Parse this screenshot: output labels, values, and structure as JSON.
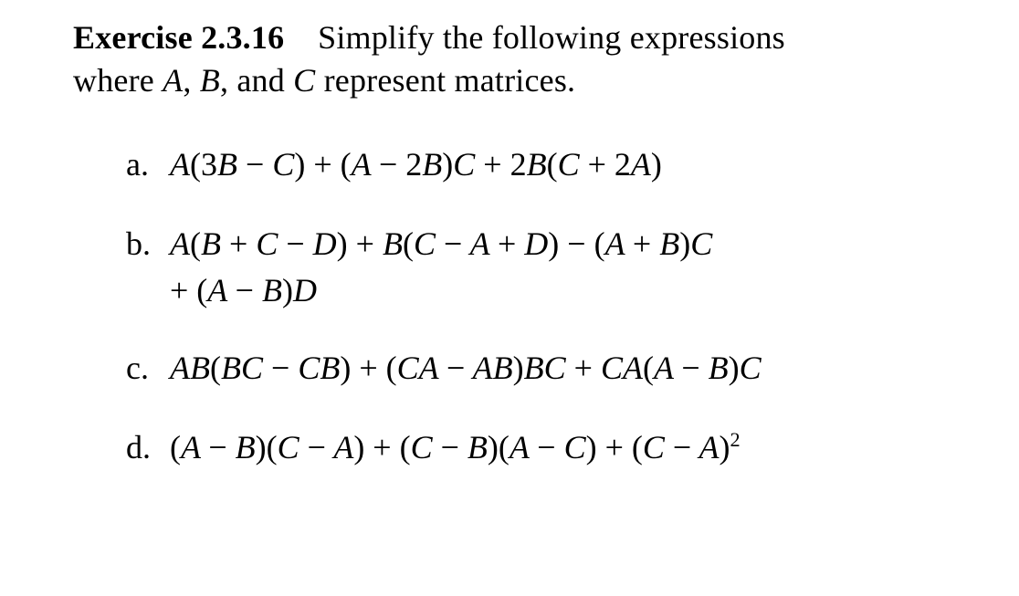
{
  "intro": {
    "exercise_label": "Exercise 2.3.16",
    "prompt_part1": "Simplify the following expressions",
    "prompt_part2": "where ",
    "var_a": "A",
    "sep1": ", ",
    "var_b": "B",
    "sep2": ", and ",
    "var_c": "C",
    "prompt_part3": " represent matrices."
  },
  "problems": {
    "a": {
      "letter": "a.",
      "expr_html": "A<span class=\"op\">(3</span>B <span class=\"op\">−</span> C<span class=\"op\">) + (</span>A <span class=\"op\">− 2</span>B<span class=\"op\">)</span>C <span class=\"op\">+ 2</span>B<span class=\"op\">(</span>C <span class=\"op\">+ 2</span>A<span class=\"op\">)</span>"
    },
    "b": {
      "letter": "b.",
      "expr_html": "A<span class=\"op\">(</span>B <span class=\"op\">+</span> C <span class=\"op\">−</span> D<span class=\"op\">) + </span>B<span class=\"op\">(</span>C <span class=\"op\">−</span> A <span class=\"op\">+</span> D<span class=\"op\">) − (</span>A <span class=\"op\">+</span> B<span class=\"op\">)</span>C<span class=\"line2\"><span class=\"op\">+ (</span>A <span class=\"op\">−</span> B<span class=\"op\">)</span>D</span>"
    },
    "c": {
      "letter": "c.",
      "expr_html": "AB<span class=\"op\">(</span>BC <span class=\"op\">−</span> CB<span class=\"op\">) + (</span>CA <span class=\"op\">−</span> AB<span class=\"op\">)</span>BC <span class=\"op\">+ </span>CA<span class=\"op\">(</span>A <span class=\"op\">−</span> B<span class=\"op\">)</span>C"
    },
    "d": {
      "letter": "d.",
      "expr_html": "<span class=\"op\">(</span>A <span class=\"op\">−</span> B<span class=\"op\">)(</span>C <span class=\"op\">−</span> A<span class=\"op\">) + (</span>C <span class=\"op\">−</span> B<span class=\"op\">)(</span>A <span class=\"op\">−</span> C<span class=\"op\">) + (</span>C <span class=\"op\">−</span> A<span class=\"op\">)</span><sup>2</sup>"
    }
  }
}
